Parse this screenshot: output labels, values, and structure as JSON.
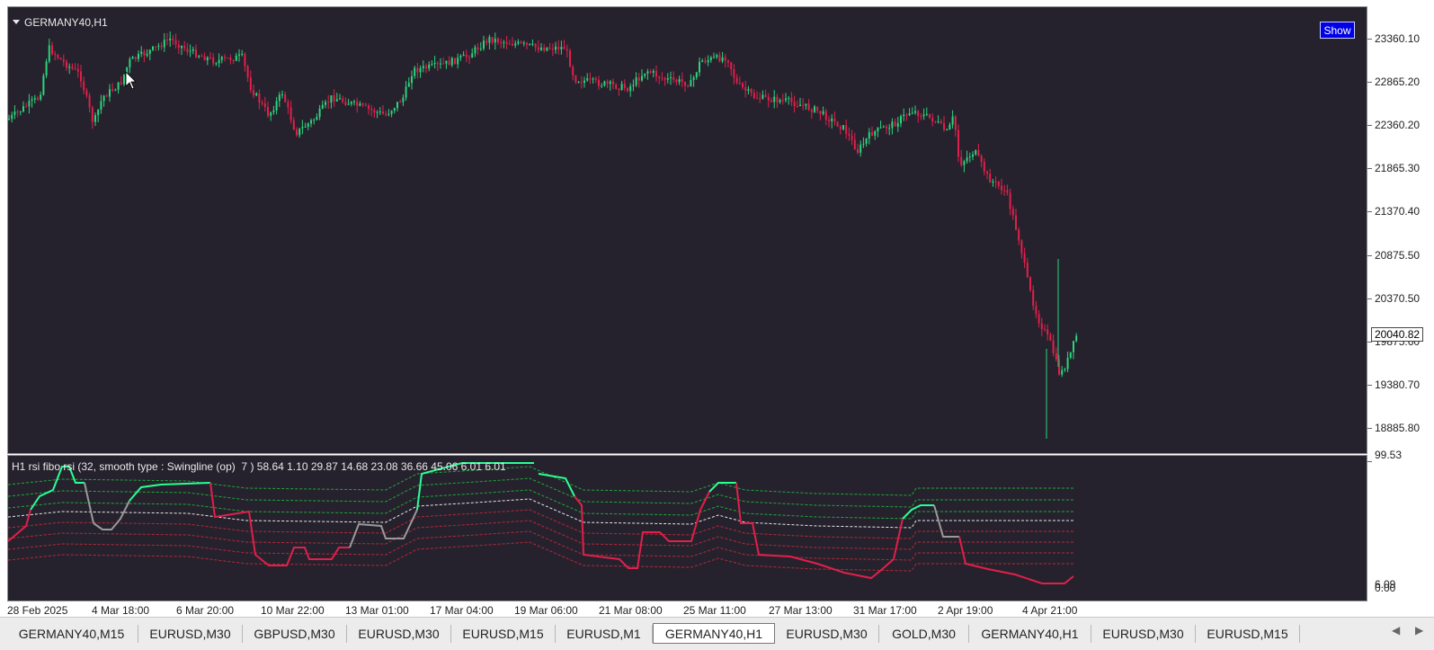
{
  "chart": {
    "title": "GERMANY40,H1",
    "show_button": "Show",
    "current_price": "20040.82",
    "price_ticks": [
      "23360.10",
      "22865.20",
      "22360.20",
      "21865.30",
      "21370.40",
      "20875.50",
      "20370.50",
      "19875.60",
      "19380.70",
      "18885.80"
    ],
    "indicator_ticks": [
      "99.53",
      "6.09",
      "0.00"
    ],
    "time_ticks": [
      "28 Feb 2025",
      "4 Mar 18:00",
      "6 Mar 20:00",
      "10 Mar 22:00",
      "13 Mar 01:00",
      "17 Mar 04:00",
      "19 Mar 06:00",
      "21 Mar 08:00",
      "25 Mar 11:00",
      "27 Mar 13:00",
      "31 Mar 17:00",
      "2 Apr 19:00",
      "4 Apr 21:00"
    ],
    "colors": {
      "background": "#26222d",
      "bull": "#2bd47c",
      "bear": "#e0204a",
      "rsi_up": "#2bff93",
      "rsi_neutral": "#9a9a9a"
    }
  },
  "indicator": {
    "label": "H1 rsi fibo rsi (32, smooth type : Swingline (op)  7 ) 58.64 1.10 29.87 14.68 23.08 36.66 45.06 6.01 6.01"
  },
  "tabs": [
    {
      "label": "GERMANY40,M15"
    },
    {
      "label": "EURUSD,M30"
    },
    {
      "label": "GBPUSD,M30"
    },
    {
      "label": "EURUSD,M30"
    },
    {
      "label": "EURUSD,M15"
    },
    {
      "label": "EURUSD,M1"
    },
    {
      "label": "GERMANY40,H1",
      "active": true
    },
    {
      "label": "EURUSD,M30"
    },
    {
      "label": "GOLD,M30"
    },
    {
      "label": "GERMANY40,H1"
    },
    {
      "label": "EURUSD,M30"
    },
    {
      "label": "EURUSD,M15"
    }
  ],
  "tab_nav": {
    "prev": "◀",
    "next": "▶"
  }
}
